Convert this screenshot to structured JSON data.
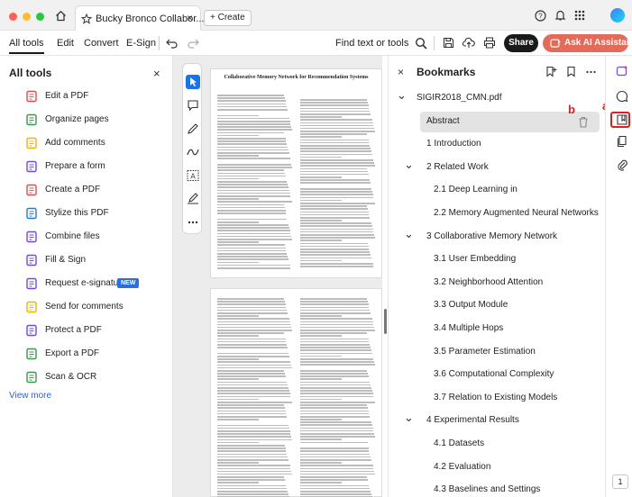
{
  "browser": {
    "tab_title": "Bucky Bronco Collabor...",
    "create_label": "Create"
  },
  "toolbar": {
    "menus": [
      "All tools",
      "Edit",
      "Convert",
      "E-Sign"
    ],
    "find_label": "Find text or tools",
    "share_label": "Share",
    "ai_label": "Ask AI Assistant"
  },
  "tools_panel": {
    "title": "All tools",
    "items": [
      {
        "label": "Edit a PDF",
        "icon": "edit-pdf-icon",
        "color": "#e5484d"
      },
      {
        "label": "Organize pages",
        "icon": "organize-pages-icon",
        "color": "#2f9e44"
      },
      {
        "label": "Add comments",
        "icon": "comment-icon",
        "color": "#f0b400"
      },
      {
        "label": "Prepare a form",
        "icon": "form-icon",
        "color": "#7048e8"
      },
      {
        "label": "Create a PDF",
        "icon": "create-pdf-icon",
        "color": "#e5484d"
      },
      {
        "label": "Stylize this PDF",
        "icon": "stylize-icon",
        "color": "#1c7ed6"
      },
      {
        "label": "Combine files",
        "icon": "combine-icon",
        "color": "#7048e8"
      },
      {
        "label": "Fill & Sign",
        "icon": "fill-sign-icon",
        "color": "#7048e8"
      },
      {
        "label": "Request e-signatures",
        "icon": "esign-icon",
        "color": "#7048e8",
        "badge": "NEW"
      },
      {
        "label": "Send for comments",
        "icon": "send-comments-icon",
        "color": "#f0b400"
      },
      {
        "label": "Protect a PDF",
        "icon": "protect-icon",
        "color": "#7048e8"
      },
      {
        "label": "Export a PDF",
        "icon": "export-icon",
        "color": "#2f9e44"
      },
      {
        "label": "Scan & OCR",
        "icon": "scan-icon",
        "color": "#2f9e44"
      }
    ],
    "view_more": "View more"
  },
  "document": {
    "title": "Collaborative Memory Network for Recommendation Systems"
  },
  "bookmarks": {
    "title": "Bookmarks",
    "items": [
      {
        "label": "SIGIR2018_CMN.pdf",
        "level": 0,
        "chevron": true
      },
      {
        "label": "Abstract",
        "level": 1,
        "chevron": false,
        "selected": true
      },
      {
        "label": "1 Introduction",
        "level": 1,
        "chevron": false
      },
      {
        "label": "2 Related Work",
        "level": 1,
        "chevron": true
      },
      {
        "label": "2.1 Deep Learning in",
        "level": 2,
        "chevron": false
      },
      {
        "label": "2.2 Memory Augmented Neural Networks",
        "level": 2,
        "chevron": false
      },
      {
        "label": "3 Collaborative Memory Network",
        "level": 1,
        "chevron": true
      },
      {
        "label": "3.1 User Embedding",
        "level": 2,
        "chevron": false
      },
      {
        "label": "3.2 Neighborhood Attention",
        "level": 2,
        "chevron": false
      },
      {
        "label": "3.3 Output Module",
        "level": 2,
        "chevron": false
      },
      {
        "label": "3.4 Multiple Hops",
        "level": 2,
        "chevron": false
      },
      {
        "label": "3.5 Parameter Estimation",
        "level": 2,
        "chevron": false
      },
      {
        "label": "3.6 Computational Complexity",
        "level": 2,
        "chevron": false
      },
      {
        "label": "3.7 Relation to Existing Models",
        "level": 2,
        "chevron": false
      },
      {
        "label": "4 Experimental Results",
        "level": 1,
        "chevron": true
      },
      {
        "label": "4.1 Datasets",
        "level": 2,
        "chevron": false
      },
      {
        "label": "4.2 Evaluation",
        "level": 2,
        "chevron": false
      },
      {
        "label": "4.3 Baselines and Settings",
        "level": 2,
        "chevron": false
      }
    ]
  },
  "annotations": {
    "a": "a",
    "b": "b"
  },
  "page_number": "1"
}
